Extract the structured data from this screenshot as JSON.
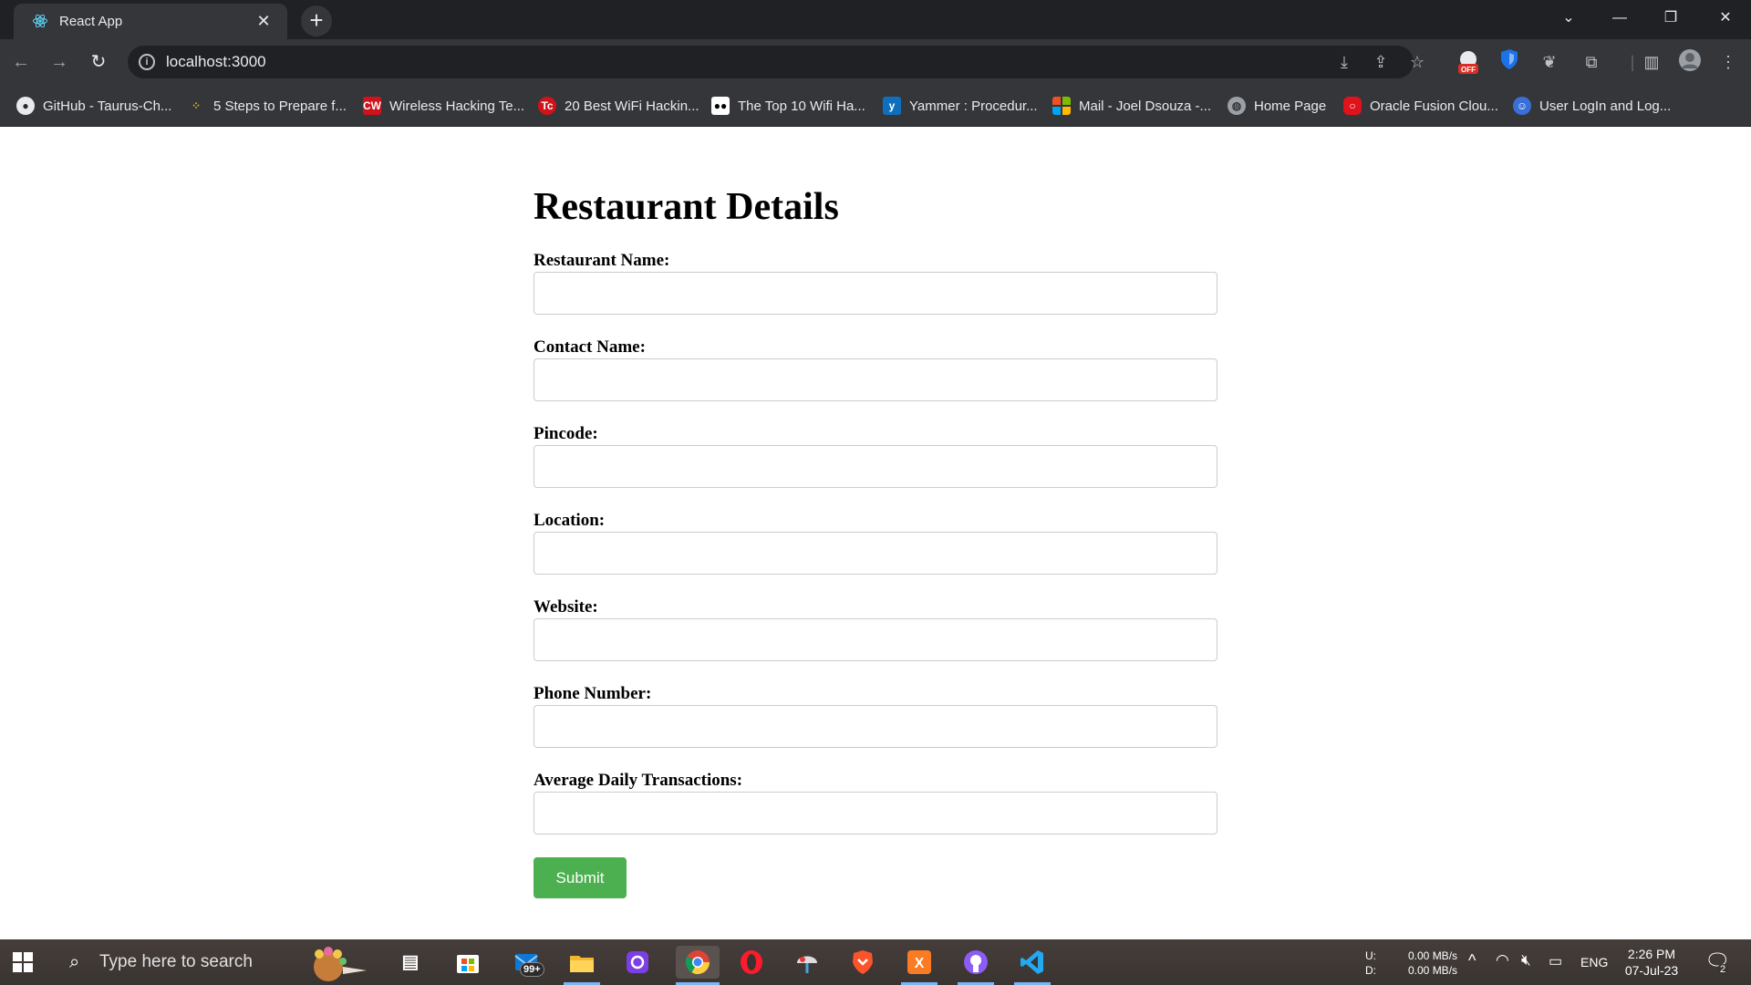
{
  "browser": {
    "tab_title": "React App",
    "tab_close": "✕",
    "new_tab": "+",
    "address": "localhost:3000",
    "bookmarks": [
      {
        "label": "GitHub - Taurus-Ch...",
        "icon": "github-icon",
        "color": "#24292e"
      },
      {
        "label": "5 Steps to Prepare f...",
        "icon": "dots-icon",
        "color": "#4a4a4a"
      },
      {
        "label": "Wireless Hacking Te...",
        "icon": "cw-icon",
        "color": "#d0121b"
      },
      {
        "label": "20 Best WiFi Hackin...",
        "icon": "tc-icon",
        "color": "#d0121b"
      },
      {
        "label": "The Top 10 Wifi Ha...",
        "icon": "medium-icon",
        "color": "#000000"
      },
      {
        "label": "Yammer : Procedur...",
        "icon": "yammer-icon",
        "color": "#106ebe"
      },
      {
        "label": "Mail - Joel Dsouza -...",
        "icon": "microsoft-icon",
        "color": "#f25022"
      },
      {
        "label": "Home Page",
        "icon": "globe-icon",
        "color": "#9aa0a6"
      },
      {
        "label": "Oracle Fusion Clou...",
        "icon": "oracle-icon",
        "color": "#e0121b"
      },
      {
        "label": "User LogIn and Log...",
        "icon": "user-login-icon",
        "color": "#3a6fd8"
      }
    ]
  },
  "form": {
    "title": "Restaurant Details",
    "fields": [
      {
        "label": "Restaurant Name:",
        "value": ""
      },
      {
        "label": "Contact Name:",
        "value": ""
      },
      {
        "label": "Pincode:",
        "value": ""
      },
      {
        "label": "Location:",
        "value": ""
      },
      {
        "label": "Website:",
        "value": ""
      },
      {
        "label": "Phone Number:",
        "value": ""
      },
      {
        "label": "Average Daily Transactions:",
        "value": ""
      }
    ],
    "submit_label": "Submit",
    "submit_color": "#4caf50"
  },
  "taskbar": {
    "search_placeholder": "Type here to search",
    "mail_badge": "99+",
    "net_up_label": "U:",
    "net_down_label": "D:",
    "net_up_value": "0.00 MB/s",
    "net_down_value": "0.00 MB/s",
    "language": "ENG",
    "time": "2:26 PM",
    "date": "07-Jul-23",
    "notification_count": "2"
  }
}
